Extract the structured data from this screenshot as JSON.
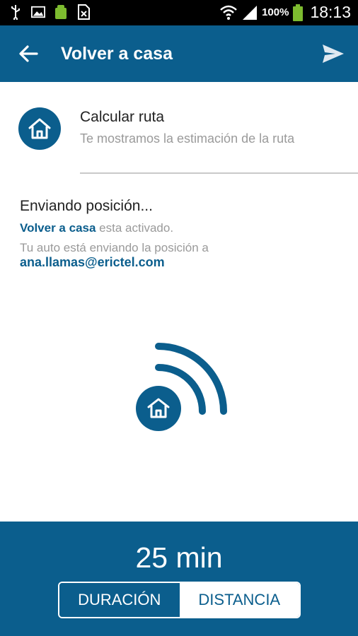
{
  "status_bar": {
    "icons": [
      "usb-icon",
      "image-icon",
      "android-icon",
      "sim-icon",
      "wifi-icon",
      "signal-icon",
      "battery-icon"
    ],
    "battery": "100%",
    "time": "18:13"
  },
  "app_bar": {
    "title": "Volver a casa",
    "icons": [
      "back-arrow-icon",
      "send-icon"
    ]
  },
  "route": {
    "title": "Calcular ruta",
    "subtitle": "Te mostramos la estimación de la ruta",
    "icon": "home-icon"
  },
  "status": {
    "sending": "Enviando posición...",
    "feature_name": "Volver a casa",
    "feature_state": " esta activado.",
    "position_text": "Tu auto está enviando la posición a",
    "email": "ana.llamas@erictel.com"
  },
  "bottom": {
    "time": "25 min",
    "tabs": {
      "duration": "DURACIÓN",
      "distance": "DISTANCIA"
    },
    "selected_tab": "DURACIÓN"
  },
  "colors": {
    "primary": "#0b5e8d",
    "white": "#ffffff",
    "muted": "#9a9a9a"
  }
}
